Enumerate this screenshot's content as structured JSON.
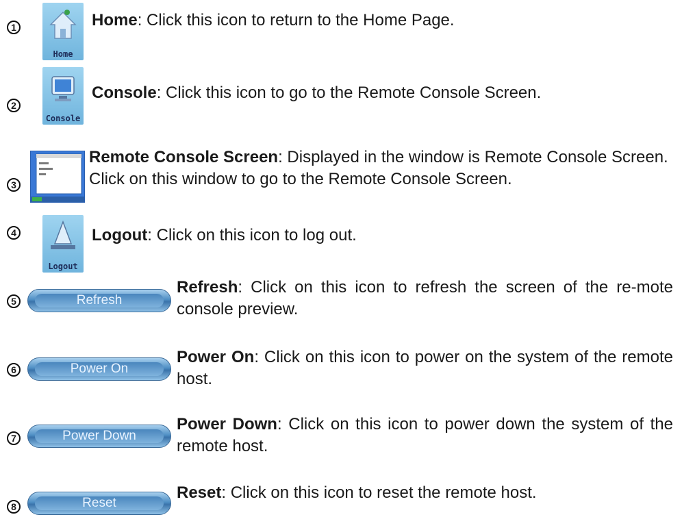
{
  "items": [
    {
      "num": "1",
      "title": "Home",
      "text": ": Click this icon to return to the Home Page.",
      "icon_caption": "Home"
    },
    {
      "num": "2",
      "title": "Console",
      "text": ": Click this icon to go to the Remote Console Screen.",
      "icon_caption": "Console"
    },
    {
      "num": "3",
      "title": "Remote Console Screen",
      "text": ": Displayed in the window is Remote Console Screen. Click on this window to go to the Remote Console Screen."
    },
    {
      "num": "4",
      "title": "Logout",
      "text": ": Click on this icon to log out.",
      "icon_caption": "Logout"
    },
    {
      "num": "5",
      "title": "Refresh",
      "text": ": Click on this icon to refresh the screen of the re-mote console preview.",
      "button_label": "Refresh"
    },
    {
      "num": "6",
      "title": "Power On",
      "text": ": Click on this icon to power on the system of the remote host.",
      "button_label": "Power On"
    },
    {
      "num": "7",
      "title": "Power Down",
      "text": ": Click on this icon to power down the system of the remote host.",
      "button_label": "Power Down"
    },
    {
      "num": "8",
      "title": "Reset",
      "text": ": Click on this icon to reset the remote host.",
      "button_label": "Reset"
    }
  ]
}
